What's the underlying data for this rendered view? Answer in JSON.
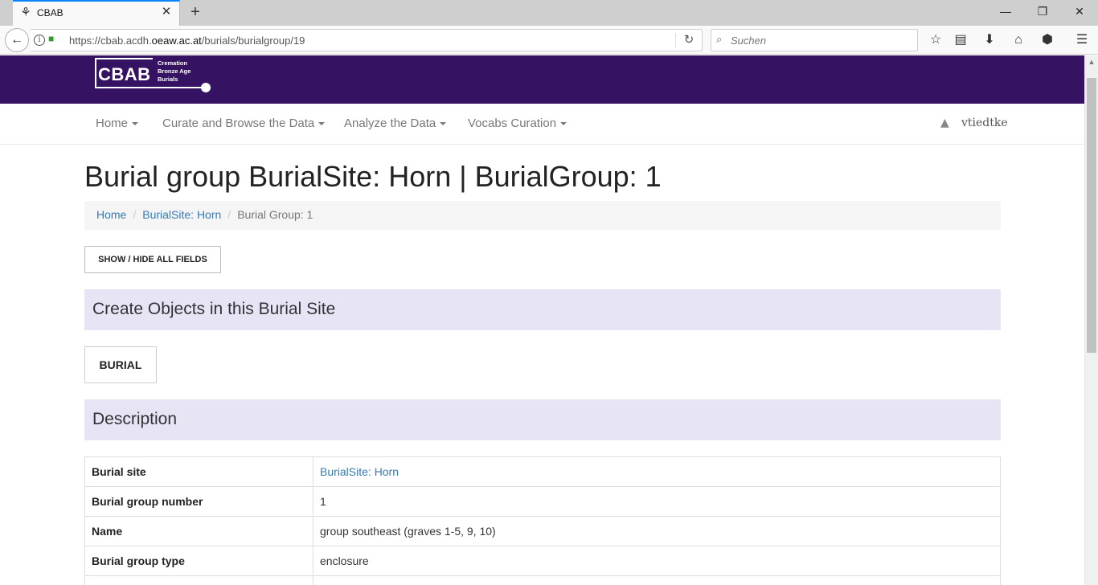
{
  "browser": {
    "tab_title": "CBAB",
    "new_tab": "+",
    "url_prefix": "https://cbab.acdh.",
    "url_domain": "oeaw.ac.at",
    "url_path": "/burials/burialgroup/19",
    "search_placeholder": "Suchen"
  },
  "header": {
    "logo_text": "CBAB",
    "logo_sub": [
      "Cremation",
      "Bronze Age",
      "Burials"
    ]
  },
  "nav": {
    "items": [
      {
        "label": "Home"
      },
      {
        "label": "Curate and Browse the Data"
      },
      {
        "label": "Analyze the Data"
      },
      {
        "label": "Vocabs Curation"
      }
    ],
    "user": "vtiedtke"
  },
  "page": {
    "title": "Burial group BurialSite: Horn | BurialGroup: 1",
    "breadcrumb": [
      "Home",
      "BurialSite: Horn",
      "Burial Group: 1"
    ],
    "toggle_button": "SHOW / HIDE ALL FIELDS",
    "create_heading": "Create Objects in this Burial Site",
    "burial_button": "BURIAL",
    "description_heading": "Description",
    "table": [
      {
        "label": "Burial site",
        "value": "BurialSite: Horn"
      },
      {
        "label": "Burial group number",
        "value": "1"
      },
      {
        "label": "Name",
        "value": "group southeast (graves 1-5, 9, 10)"
      },
      {
        "label": "Burial group type",
        "value": "enclosure"
      }
    ]
  },
  "colors": {
    "header_bg": "#361262",
    "section_bg": "#e6e4f5",
    "link": "#337ab7"
  }
}
